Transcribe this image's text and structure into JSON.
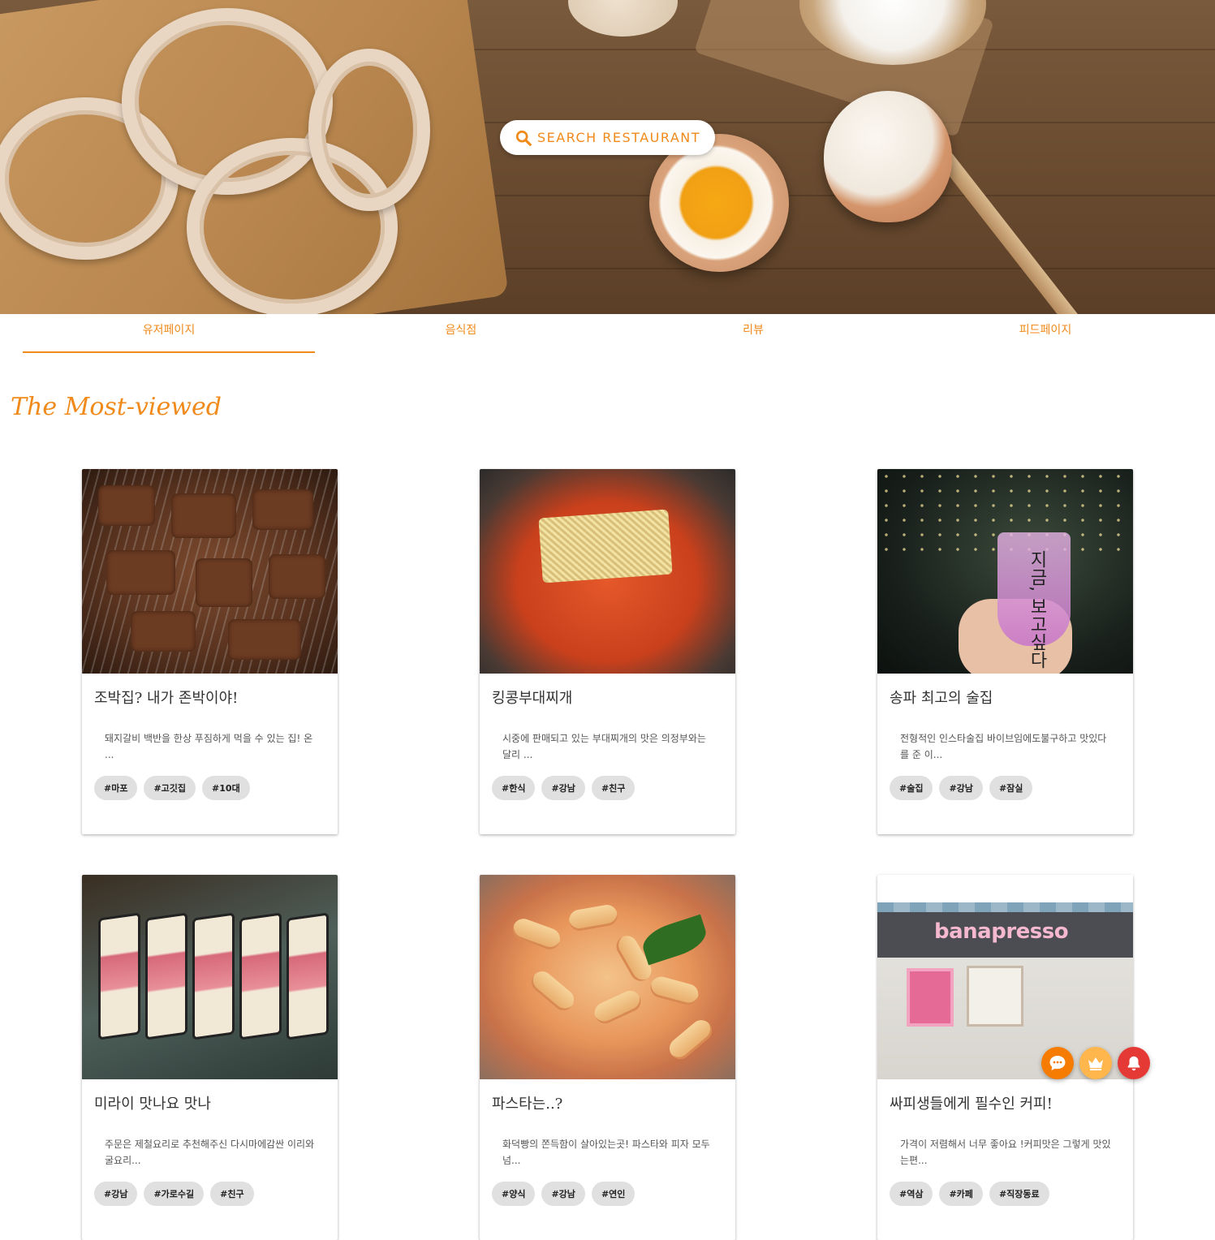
{
  "hero": {
    "search_label": "SEARCH RESTAURANT",
    "icons": {
      "search": "search-icon"
    }
  },
  "tabs": [
    {
      "label": "유저페이지",
      "active": true
    },
    {
      "label": "음식점",
      "active": false
    },
    {
      "label": "리뷰",
      "active": false
    },
    {
      "label": "피드페이지",
      "active": false
    }
  ],
  "section": {
    "title": "The Most-viewed"
  },
  "cards": [
    {
      "title": "조박집? 내가 존박이야!",
      "desc": "돼지갈비 백반을 한상 푸짐하게 먹을 수 있는 집! 온 ...",
      "tags": [
        "#마포",
        "#고깃집",
        "#10대"
      ],
      "image": "grilled-meat"
    },
    {
      "title": "킹콩부대찌개",
      "desc": "시중에 판매되고 있는 부대찌개의 맛은 의정부와는 달리 ...",
      "tags": [
        "#한식",
        "#강남",
        "#친구"
      ],
      "image": "army-stew"
    },
    {
      "title": "송파 최고의 술집",
      "desc": "전형적인 인스타술집 바이브임에도불구하고 맛있다를 준 이...",
      "tags": [
        "#술집",
        "#강남",
        "#잠실"
      ],
      "image": "cocktail-glass",
      "image_text": "지금, 보고싶다"
    },
    {
      "title": "미라이 맛나요 맛나",
      "desc": "주문은 제철요리로 추천해주신 다시마에감싼 이리와 굴요리...",
      "tags": [
        "#강남",
        "#가로수길",
        "#친구"
      ],
      "image": "fish-sandwich"
    },
    {
      "title": "파스타는..?",
      "desc": "화덕빵의 쫀득함이 살아있는곳! 파스타와 피자 모두 넘...",
      "tags": [
        "#양식",
        "#강남",
        "#연인"
      ],
      "image": "baked-pasta"
    },
    {
      "title": "싸피생들에게 필수인 커피!",
      "desc": "가격이 저렴해서 너무 좋아요 !커피맛은 그렇게 맛있는편...",
      "tags": [
        "#역삼",
        "#카페",
        "#직장동료"
      ],
      "image": "cafe-storefront",
      "image_text": "banapresso"
    }
  ],
  "fabs": [
    {
      "name": "chat-icon",
      "color": "#f57c00"
    },
    {
      "name": "crown-icon",
      "color": "#ffb74d"
    },
    {
      "name": "bell-icon",
      "color": "#e53935"
    }
  ],
  "colors": {
    "accent": "#f08a1a",
    "tag_bg": "#e0e0e0"
  }
}
